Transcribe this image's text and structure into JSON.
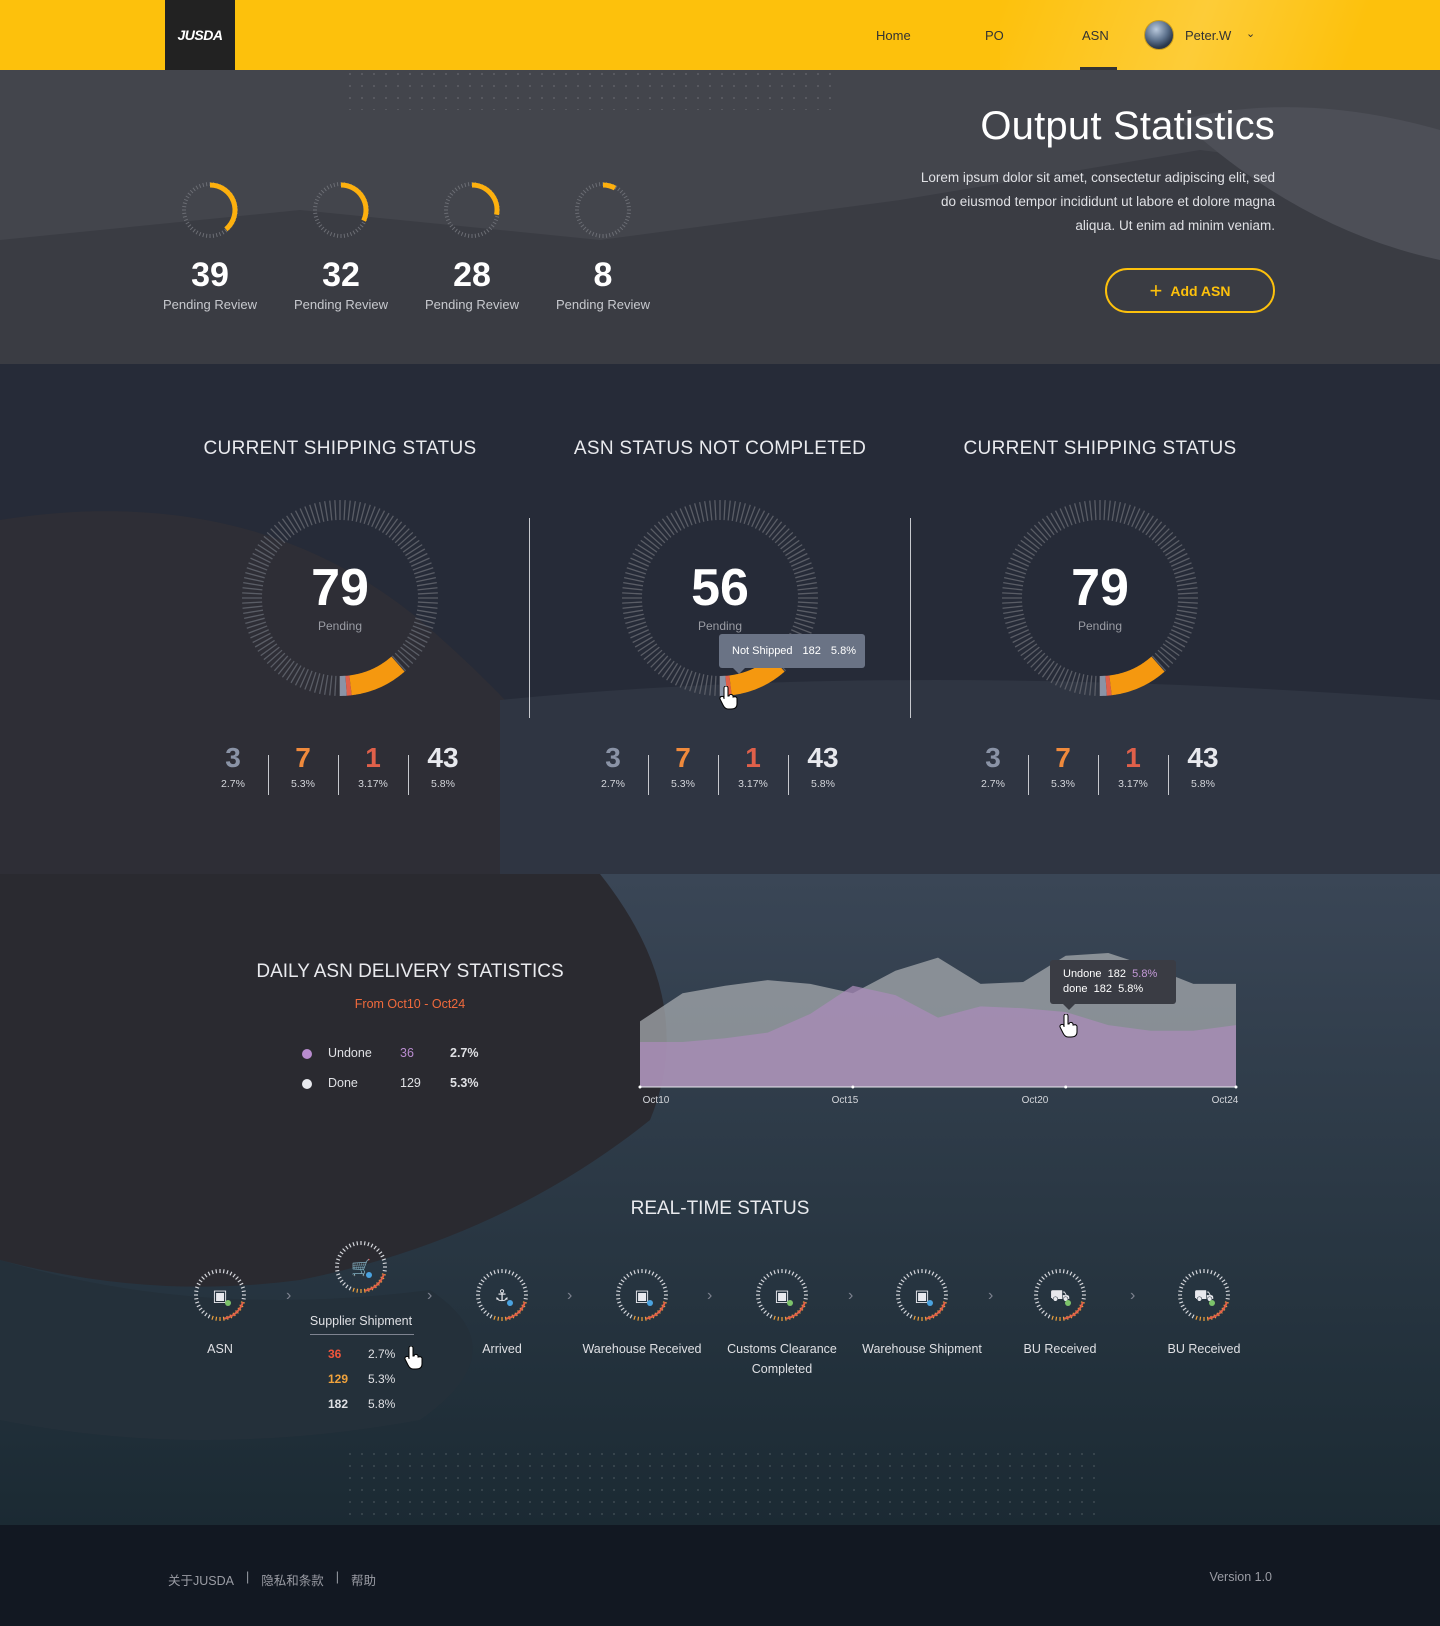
{
  "header": {
    "logo_text": "JUSDA",
    "nav": [
      {
        "label": "Home",
        "active": false
      },
      {
        "label": "PO",
        "active": false
      },
      {
        "label": "ASN",
        "active": true
      }
    ],
    "user": {
      "name": "Peter.W"
    },
    "colors": {
      "brand": "#fdc10c",
      "dark": "#222222"
    }
  },
  "hero": {
    "title": "Output Statistics",
    "description": "Lorem ipsum dolor sit amet, consectetur adipiscing elit, sed do eiusmod tempor incididunt ut labore et dolore magna aliqua. Ut enim ad minim veniam.",
    "add_button": "Add ASN",
    "stats": [
      {
        "value": "39",
        "label": "Pending Review",
        "progress": 0.39
      },
      {
        "value": "32",
        "label": "Pending Review",
        "progress": 0.32
      },
      {
        "value": "28",
        "label": "Pending Review",
        "progress": 0.28
      },
      {
        "value": "8",
        "label": "Pending Review",
        "progress": 0.08
      }
    ]
  },
  "status_panels": [
    {
      "title": "CURRENT SHIPPING STATUS",
      "value": "79",
      "label": "Pending",
      "breakdown": [
        {
          "value": "3",
          "pct": "2.7%",
          "color": "#8a93a6"
        },
        {
          "value": "7",
          "pct": "5.3%",
          "color": "#f08a3c"
        },
        {
          "value": "1",
          "pct": "3.17%",
          "color": "#e0604a"
        },
        {
          "value": "43",
          "pct": "5.8%",
          "color": "#e8e9ee"
        }
      ]
    },
    {
      "title": "ASN STATUS NOT COMPLETED",
      "value": "56",
      "label": "Pending",
      "breakdown": [
        {
          "value": "3",
          "pct": "2.7%",
          "color": "#8a93a6"
        },
        {
          "value": "7",
          "pct": "5.3%",
          "color": "#f08a3c"
        },
        {
          "value": "1",
          "pct": "3.17%",
          "color": "#e0604a"
        },
        {
          "value": "43",
          "pct": "5.8%",
          "color": "#e8e9ee"
        }
      ]
    },
    {
      "title": "CURRENT SHIPPING STATUS",
      "value": "79",
      "label": "Pending",
      "breakdown": [
        {
          "value": "3",
          "pct": "2.7%",
          "color": "#8a93a6"
        },
        {
          "value": "7",
          "pct": "5.3%",
          "color": "#f08a3c"
        },
        {
          "value": "1",
          "pct": "3.17%",
          "color": "#e0604a"
        },
        {
          "value": "43",
          "pct": "5.8%",
          "color": "#e8e9ee"
        }
      ]
    }
  ],
  "tooltip_not_shipped": {
    "label": "Not Shipped",
    "value": "182",
    "pct": "5.8%"
  },
  "daily": {
    "title": "DAILY ASN DELIVERY STATISTICS",
    "range": "From Oct10 - Oct24",
    "legend": [
      {
        "name": "Undone",
        "count": "36",
        "pct": "2.7%",
        "color": "#b98ccf"
      },
      {
        "name": "Done",
        "count": "129",
        "pct": "5.3%",
        "color": "#e8e9ee"
      }
    ],
    "tooltip": {
      "undone_label": "Undone",
      "undone_value": "182",
      "undone_pct": "5.8%",
      "done_label": "done",
      "done_value": "182",
      "done_pct": "5.8%"
    },
    "x_ticks": [
      "Oct10",
      "Oct15",
      "Oct20",
      "Oct24"
    ]
  },
  "chart_data": {
    "type": "area",
    "x": [
      "Oct10",
      "Oct11",
      "Oct12",
      "Oct13",
      "Oct14",
      "Oct15",
      "Oct16",
      "Oct17",
      "Oct18",
      "Oct19",
      "Oct20",
      "Oct21",
      "Oct22",
      "Oct23",
      "Oct24"
    ],
    "series": [
      {
        "name": "Done",
        "values": [
          70,
          100,
          108,
          114,
          110,
          100,
          124,
          138,
          110,
          112,
          140,
          143,
          128,
          110,
          110
        ],
        "color": "#a6a9ad"
      },
      {
        "name": "Undone",
        "values": [
          48,
          48,
          52,
          58,
          78,
          108,
          98,
          74,
          86,
          84,
          80,
          66,
          60,
          60,
          66
        ],
        "color": "#a98bb8"
      }
    ]
  },
  "realtime": {
    "title": "REAL-TIME STATUS",
    "steps": [
      {
        "label": "ASN",
        "icon": "clipboard-icon"
      },
      {
        "label": "Supplier Shipment",
        "icon": "cart-icon"
      },
      {
        "label": "Arrived",
        "icon": "anchor-icon"
      },
      {
        "label": "Warehouse Received",
        "icon": "warehouse-icon"
      },
      {
        "label": "Customs Clearance Completed",
        "icon": "customs-icon"
      },
      {
        "label": "Warehouse Shipment",
        "icon": "warehouse-icon"
      },
      {
        "label": "BU Received",
        "icon": "truck-icon"
      },
      {
        "label": "BU Received",
        "icon": "truck-icon"
      }
    ],
    "detail": [
      {
        "value": "36",
        "pct": "2.7%",
        "color": "#f0553c"
      },
      {
        "value": "129",
        "pct": "5.3%",
        "color": "#f0a23c"
      },
      {
        "value": "182",
        "pct": "5.8%",
        "color": "#dfe0e4"
      }
    ]
  },
  "footer": {
    "links": [
      "关于JUSDA",
      "隐私和条款",
      "帮助"
    ],
    "separator": "|",
    "version": "Version 1.0"
  }
}
